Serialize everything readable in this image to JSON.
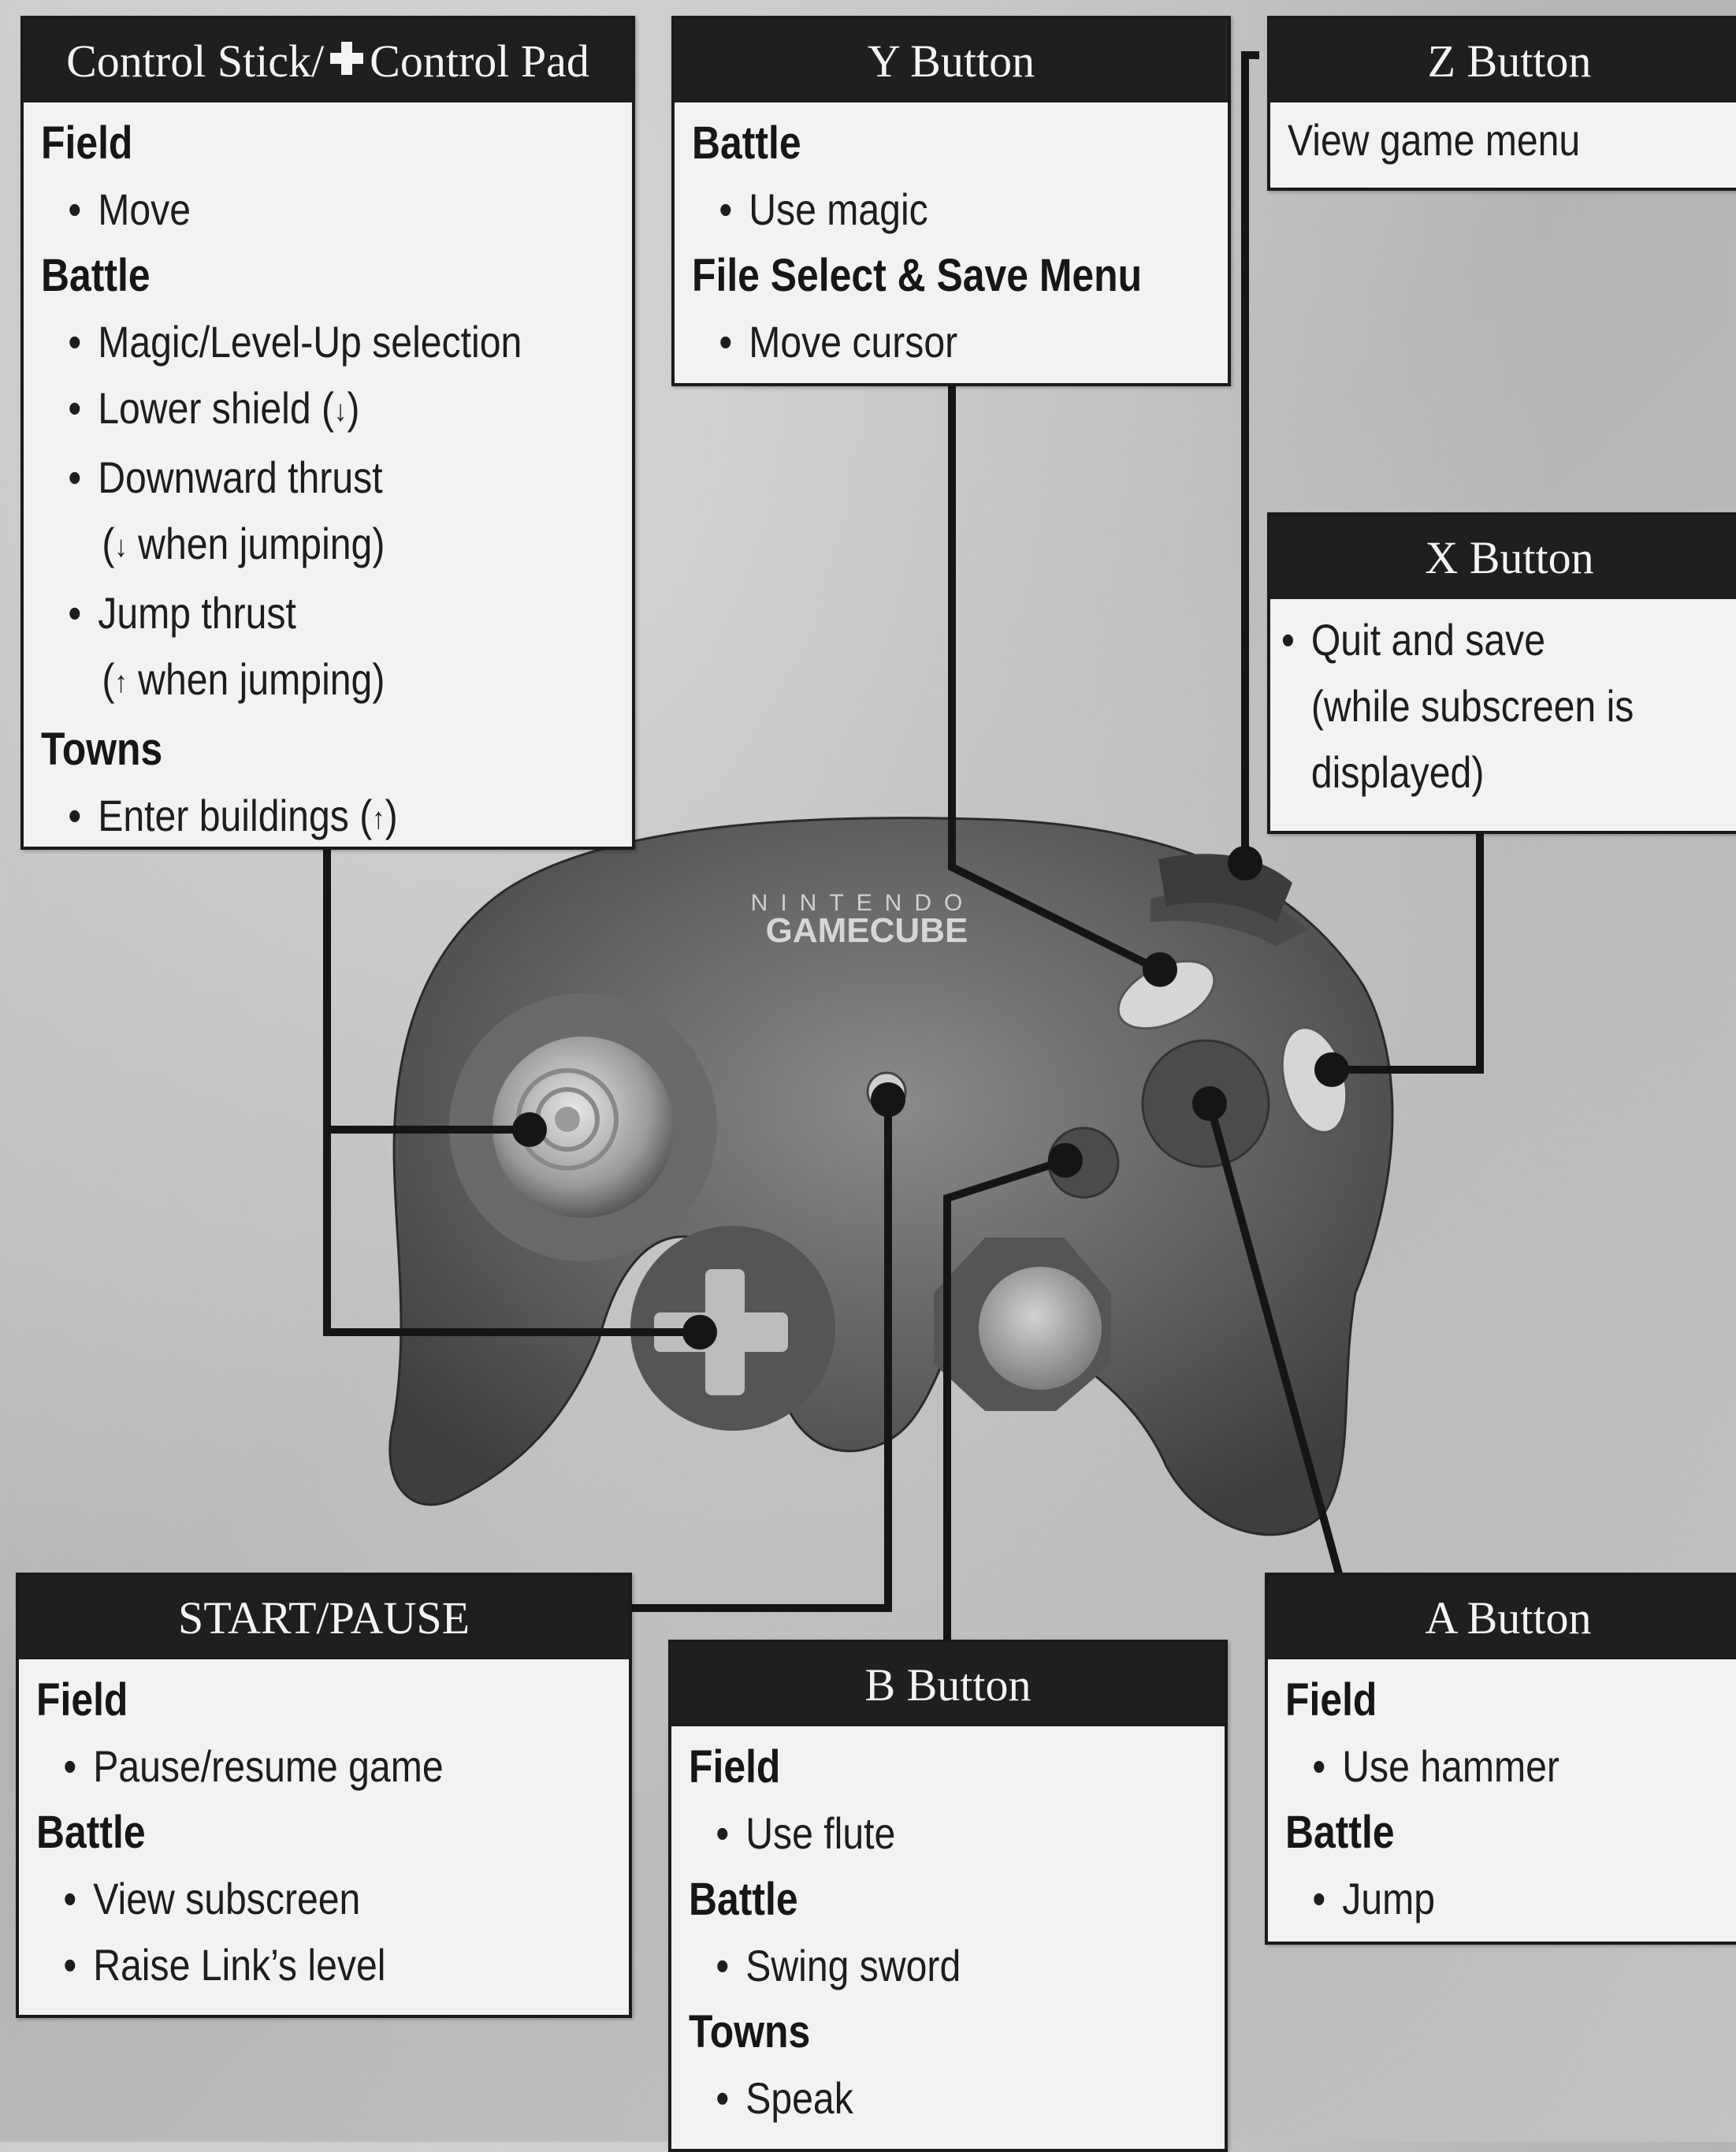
{
  "controller": {
    "brand_top": "NINTENDO",
    "brand_bottom": "GAMECUBE"
  },
  "control_stick": {
    "title_part1": "Control Stick/",
    "title_icon": "plus-cross-icon",
    "title_part2": "Control Pad",
    "field_label": "Field",
    "field_items": [
      "Move"
    ],
    "battle_label": "Battle",
    "battle_item_1": "Magic/Level-Up selection",
    "battle_item_2_text": "Lower shield (",
    "battle_item_2_end": ")",
    "battle_item_3": "Downward thrust",
    "battle_item_3_cont_open": "(",
    "battle_item_3_cont_text": " when jumping)",
    "battle_item_4": "Jump thrust",
    "battle_item_4_cont_open": "(",
    "battle_item_4_cont_text": " when jumping)",
    "towns_label": "Towns",
    "towns_item_text": "Enter buildings (",
    "towns_item_end": ")",
    "arrow_down": "↓",
    "arrow_up": "↑"
  },
  "y_button": {
    "title": "Y Button",
    "battle_label": "Battle",
    "battle_item": "Use magic",
    "file_label": "File Select & Save Menu",
    "file_item": "Move cursor"
  },
  "z_button": {
    "title": "Z Button",
    "item": "View game menu"
  },
  "x_button": {
    "title": "X Button",
    "line1": "Quit and save",
    "line2": "(while subscreen is",
    "line3": "displayed)"
  },
  "start_pause": {
    "title": "START/PAUSE",
    "field_label": "Field",
    "field_item": "Pause/resume game",
    "battle_label": "Battle",
    "battle_item_1": "View subscreen",
    "battle_item_2": "Raise Link’s level"
  },
  "b_button": {
    "title": "B Button",
    "field_label": "Field",
    "field_item": "Use flute",
    "battle_label": "Battle",
    "battle_item": "Swing sword",
    "towns_label": "Towns",
    "towns_item": "Speak"
  },
  "a_button": {
    "title": "A Button",
    "field_label": "Field",
    "field_item": "Use hammer",
    "battle_label": "Battle",
    "battle_item": "Jump"
  },
  "bullet": "•"
}
